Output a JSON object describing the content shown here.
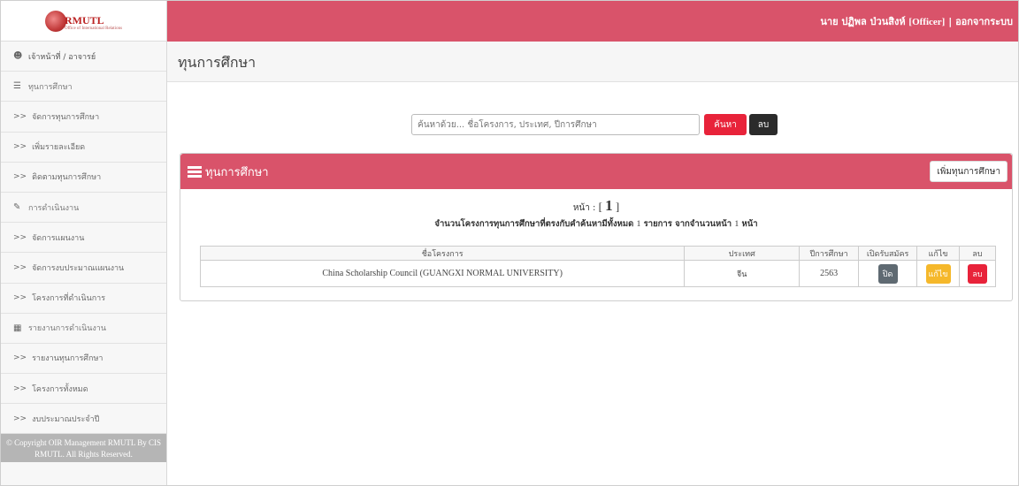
{
  "brand": {
    "logo_text": "RMUTL",
    "logo_sub": "Office of International Relations"
  },
  "topbar": {
    "user_name": "นาย ปฏิพล ป่วนสิงห์",
    "role": "[Officer]",
    "separator": "|",
    "logout": "ออกจากระบบ"
  },
  "sidebar": {
    "items": [
      {
        "label": "เจ้าหน้าที่ / อาจารย์",
        "type": "header",
        "icon": "user-icon"
      },
      {
        "label": "ทุนการศึกษา",
        "type": "section",
        "icon": "scholarship-icon"
      },
      {
        "label": "จัดการทุนการศึกษา",
        "type": "link",
        "prefix": ">>"
      },
      {
        "label": "เพิ่มรายละเอียด",
        "type": "link",
        "prefix": ">>"
      },
      {
        "label": "ติดตามทุนการศึกษา",
        "type": "link",
        "prefix": ">>"
      },
      {
        "label": "การดำเนินงาน",
        "type": "section",
        "icon": "operation-icon"
      },
      {
        "label": "จัดการแผนงาน",
        "type": "link",
        "prefix": ">>"
      },
      {
        "label": "จัดการงบประมาณแผนงาน",
        "type": "link",
        "prefix": ">>"
      },
      {
        "label": "โครงการที่ดำเนินการ",
        "type": "link",
        "prefix": ">>"
      },
      {
        "label": "รายงานการดำเนินงาน",
        "type": "section",
        "icon": "report-icon"
      },
      {
        "label": "รายงานทุนการศึกษา",
        "type": "link",
        "prefix": ">>"
      },
      {
        "label": "โครงการทั้งหมด",
        "type": "link",
        "prefix": ">>"
      },
      {
        "label": "งบประมาณประจำปี",
        "type": "link",
        "prefix": ">>"
      }
    ],
    "copyright": "© Copyright OIR Management RMUTL By CIS RMUTL. All Rights Reserved."
  },
  "page": {
    "title": "ทุนการศึกษา"
  },
  "search": {
    "placeholder": "ค้นหาด้วย... ชื่อโครงการ, ประเทศ, ปีการศึกษา",
    "value": "",
    "search_label": "ค้นหา",
    "clear_label": "ลบ"
  },
  "panel": {
    "title": "ทุนการศึกษา",
    "add_label": "เพิ่มทุนการศึกษา",
    "page_label": "หน้า :",
    "page_open": "[",
    "page_number": "1",
    "page_close": "]",
    "summary_pre": "จำนวนโครงการทุนการศึกษาที่ตรงกับคำค้นหามีทั้งหมด",
    "summary_count": "1",
    "summary_mid": "รายการ จากจำนวนหน้า",
    "summary_pages": "1",
    "summary_post": "หน้า"
  },
  "table": {
    "headers": [
      "ชื่อโครงการ",
      "ประเทศ",
      "ปีการศึกษา",
      "เปิดรับสมัคร",
      "แก้ไข",
      "ลบ"
    ],
    "rows": [
      {
        "name": "China Scholarship Council (GUANGXI NORMAL UNIVERSITY)",
        "country": "จีน",
        "year": "2563",
        "status_label": "ปิด",
        "edit_label": "แก้ไข",
        "delete_label": "ลบ"
      }
    ]
  },
  "colors": {
    "primary": "#d9536a",
    "danger": "#e8233a",
    "warning": "#f5b82b",
    "dark": "#2b2b2b",
    "muted": "#5f6a72"
  }
}
